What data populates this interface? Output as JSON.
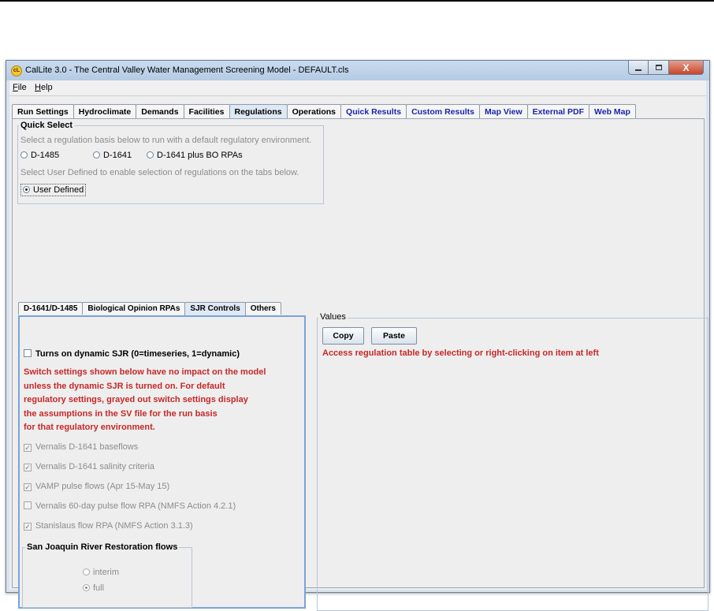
{
  "window": {
    "title": "CalLite 3.0 -  The Central Valley Water Management Screening Model - DEFAULT.cls",
    "icon_letter": "cL",
    "close_glyph": "X",
    "colors": {
      "accent_blue": "#1a25a8",
      "warning_red": "#c62828",
      "title_bar": "#c9dbef"
    }
  },
  "menu": {
    "file": "File",
    "help": "Help"
  },
  "main_tabs": [
    {
      "label": "Run Settings",
      "blue": false
    },
    {
      "label": "Hydroclimate",
      "blue": false
    },
    {
      "label": "Demands",
      "blue": false
    },
    {
      "label": "Facilities",
      "blue": false
    },
    {
      "label": "Regulations",
      "blue": false,
      "selected": true
    },
    {
      "label": "Operations",
      "blue": false
    },
    {
      "label": "Quick Results",
      "blue": true
    },
    {
      "label": "Custom Results",
      "blue": true
    },
    {
      "label": "Map View",
      "blue": true
    },
    {
      "label": "External PDF",
      "blue": true
    },
    {
      "label": "Web Map",
      "blue": true
    }
  ],
  "quick_select": {
    "title": "Quick Select",
    "instruction": "Select a regulation basis below to run with a default regulatory environment.",
    "options": [
      "D-1485",
      "D-1641",
      "D-1641 plus BO RPAs"
    ],
    "user_defined_hint": "Select User Defined to enable selection of regulations on the tabs below.",
    "user_defined": "User Defined"
  },
  "sub_tabs": [
    {
      "label": "D-1641/D-1485"
    },
    {
      "label": "Biological Opinion RPAs"
    },
    {
      "label": "SJR Controls",
      "selected": true
    },
    {
      "label": "Others"
    }
  ],
  "sjr": {
    "dynamic_checkbox": "Turns on dynamic SJR (0=timeseries, 1=dynamic)",
    "warning_lines": [
      "Switch settings shown below have no impact on the model",
      "unless the dynamic SJR is turned on. For default",
      "regulatory settings, grayed out switch settings display",
      "the assumptions in the SV file for the run basis",
      "for that regulatory environment."
    ],
    "switches": [
      {
        "label": "Vernalis D-1641 baseflows",
        "checked": true
      },
      {
        "label": "Vernalis D-1641 salinity criteria",
        "checked": true
      },
      {
        "label": "VAMP pulse flows (Apr 15-May 15)",
        "checked": true
      },
      {
        "label": "Vernalis 60-day pulse flow RPA (NMFS Action 4.2.1)",
        "checked": false
      },
      {
        "label": "Stanislaus flow RPA (NMFS Action 3.1.3)",
        "checked": true
      }
    ],
    "restoration": {
      "title": "San Joaquin River Restoration flows",
      "interim": "interim",
      "full": "full",
      "selected": "full"
    }
  },
  "values": {
    "title": "Values",
    "copy": "Copy",
    "paste": "Paste",
    "message": "Access regulation table by selecting or right-clicking on item at left"
  }
}
